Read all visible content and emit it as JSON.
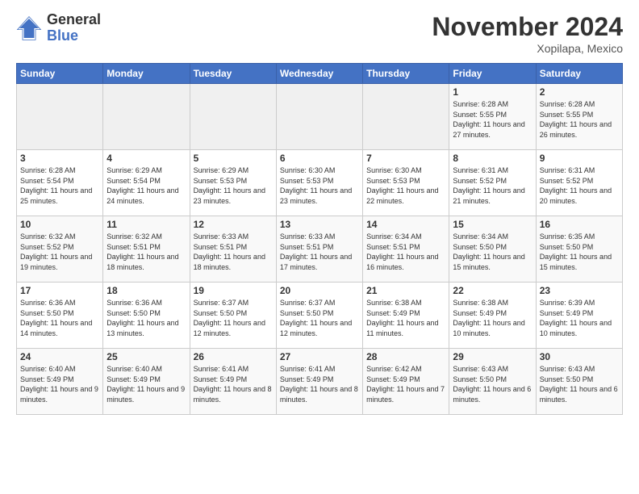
{
  "header": {
    "logo_general": "General",
    "logo_blue": "Blue",
    "month_title": "November 2024",
    "location": "Xopilapa, Mexico"
  },
  "days_of_week": [
    "Sunday",
    "Monday",
    "Tuesday",
    "Wednesday",
    "Thursday",
    "Friday",
    "Saturday"
  ],
  "weeks": [
    [
      {
        "day": "",
        "info": ""
      },
      {
        "day": "",
        "info": ""
      },
      {
        "day": "",
        "info": ""
      },
      {
        "day": "",
        "info": ""
      },
      {
        "day": "",
        "info": ""
      },
      {
        "day": "1",
        "info": "Sunrise: 6:28 AM\nSunset: 5:55 PM\nDaylight: 11 hours and 27 minutes."
      },
      {
        "day": "2",
        "info": "Sunrise: 6:28 AM\nSunset: 5:55 PM\nDaylight: 11 hours and 26 minutes."
      }
    ],
    [
      {
        "day": "3",
        "info": "Sunrise: 6:28 AM\nSunset: 5:54 PM\nDaylight: 11 hours and 25 minutes."
      },
      {
        "day": "4",
        "info": "Sunrise: 6:29 AM\nSunset: 5:54 PM\nDaylight: 11 hours and 24 minutes."
      },
      {
        "day": "5",
        "info": "Sunrise: 6:29 AM\nSunset: 5:53 PM\nDaylight: 11 hours and 23 minutes."
      },
      {
        "day": "6",
        "info": "Sunrise: 6:30 AM\nSunset: 5:53 PM\nDaylight: 11 hours and 23 minutes."
      },
      {
        "day": "7",
        "info": "Sunrise: 6:30 AM\nSunset: 5:53 PM\nDaylight: 11 hours and 22 minutes."
      },
      {
        "day": "8",
        "info": "Sunrise: 6:31 AM\nSunset: 5:52 PM\nDaylight: 11 hours and 21 minutes."
      },
      {
        "day": "9",
        "info": "Sunrise: 6:31 AM\nSunset: 5:52 PM\nDaylight: 11 hours and 20 minutes."
      }
    ],
    [
      {
        "day": "10",
        "info": "Sunrise: 6:32 AM\nSunset: 5:52 PM\nDaylight: 11 hours and 19 minutes."
      },
      {
        "day": "11",
        "info": "Sunrise: 6:32 AM\nSunset: 5:51 PM\nDaylight: 11 hours and 18 minutes."
      },
      {
        "day": "12",
        "info": "Sunrise: 6:33 AM\nSunset: 5:51 PM\nDaylight: 11 hours and 18 minutes."
      },
      {
        "day": "13",
        "info": "Sunrise: 6:33 AM\nSunset: 5:51 PM\nDaylight: 11 hours and 17 minutes."
      },
      {
        "day": "14",
        "info": "Sunrise: 6:34 AM\nSunset: 5:51 PM\nDaylight: 11 hours and 16 minutes."
      },
      {
        "day": "15",
        "info": "Sunrise: 6:34 AM\nSunset: 5:50 PM\nDaylight: 11 hours and 15 minutes."
      },
      {
        "day": "16",
        "info": "Sunrise: 6:35 AM\nSunset: 5:50 PM\nDaylight: 11 hours and 15 minutes."
      }
    ],
    [
      {
        "day": "17",
        "info": "Sunrise: 6:36 AM\nSunset: 5:50 PM\nDaylight: 11 hours and 14 minutes."
      },
      {
        "day": "18",
        "info": "Sunrise: 6:36 AM\nSunset: 5:50 PM\nDaylight: 11 hours and 13 minutes."
      },
      {
        "day": "19",
        "info": "Sunrise: 6:37 AM\nSunset: 5:50 PM\nDaylight: 11 hours and 12 minutes."
      },
      {
        "day": "20",
        "info": "Sunrise: 6:37 AM\nSunset: 5:50 PM\nDaylight: 11 hours and 12 minutes."
      },
      {
        "day": "21",
        "info": "Sunrise: 6:38 AM\nSunset: 5:49 PM\nDaylight: 11 hours and 11 minutes."
      },
      {
        "day": "22",
        "info": "Sunrise: 6:38 AM\nSunset: 5:49 PM\nDaylight: 11 hours and 10 minutes."
      },
      {
        "day": "23",
        "info": "Sunrise: 6:39 AM\nSunset: 5:49 PM\nDaylight: 11 hours and 10 minutes."
      }
    ],
    [
      {
        "day": "24",
        "info": "Sunrise: 6:40 AM\nSunset: 5:49 PM\nDaylight: 11 hours and 9 minutes."
      },
      {
        "day": "25",
        "info": "Sunrise: 6:40 AM\nSunset: 5:49 PM\nDaylight: 11 hours and 9 minutes."
      },
      {
        "day": "26",
        "info": "Sunrise: 6:41 AM\nSunset: 5:49 PM\nDaylight: 11 hours and 8 minutes."
      },
      {
        "day": "27",
        "info": "Sunrise: 6:41 AM\nSunset: 5:49 PM\nDaylight: 11 hours and 8 minutes."
      },
      {
        "day": "28",
        "info": "Sunrise: 6:42 AM\nSunset: 5:49 PM\nDaylight: 11 hours and 7 minutes."
      },
      {
        "day": "29",
        "info": "Sunrise: 6:43 AM\nSunset: 5:50 PM\nDaylight: 11 hours and 6 minutes."
      },
      {
        "day": "30",
        "info": "Sunrise: 6:43 AM\nSunset: 5:50 PM\nDaylight: 11 hours and 6 minutes."
      }
    ]
  ]
}
